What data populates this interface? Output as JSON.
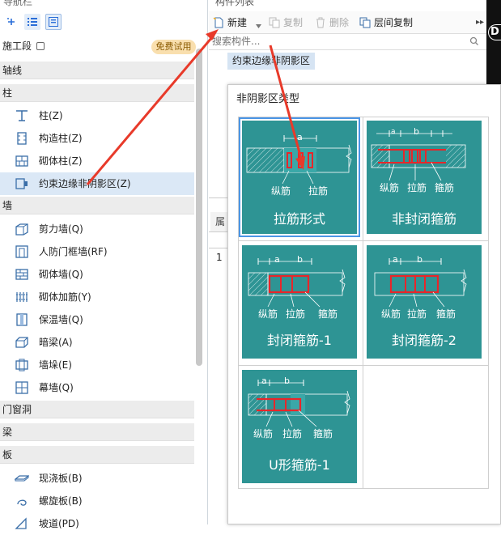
{
  "nav": {
    "title": "导航栏",
    "segment_label": "施工段",
    "free_badge": "免费试用",
    "groups": [
      {
        "label": "轴线"
      },
      {
        "label": "柱"
      },
      {
        "label": "墙"
      },
      {
        "label": "门窗洞"
      },
      {
        "label": "梁"
      },
      {
        "label": "板"
      }
    ],
    "items": [
      {
        "label": "柱(Z)",
        "icon": "column-icon"
      },
      {
        "label": "构造柱(Z)",
        "icon": "construction-column-icon"
      },
      {
        "label": "砌体柱(Z)",
        "icon": "masonry-column-icon"
      },
      {
        "label": "约束边缘非阴影区(Z)",
        "icon": "constraint-edge-icon"
      },
      {
        "label": "剪力墙(Q)",
        "icon": "shear-wall-icon"
      },
      {
        "label": "人防门框墙(RF)",
        "icon": "civil-defense-door-wall-icon"
      },
      {
        "label": "砌体墙(Q)",
        "icon": "masonry-wall-icon"
      },
      {
        "label": "砌体加筋(Y)",
        "icon": "masonry-rebar-icon"
      },
      {
        "label": "保温墙(Q)",
        "icon": "insulation-wall-icon"
      },
      {
        "label": "暗梁(A)",
        "icon": "hidden-beam-icon"
      },
      {
        "label": "墙垛(E)",
        "icon": "wall-pier-icon"
      },
      {
        "label": "幕墙(Q)",
        "icon": "curtain-wall-icon"
      },
      {
        "label": "现浇板(B)",
        "icon": "cast-slab-icon"
      },
      {
        "label": "螺旋板(B)",
        "icon": "spiral-slab-icon"
      },
      {
        "label": "坡道(PD)",
        "icon": "ramp-icon"
      }
    ]
  },
  "components": {
    "title": "构件列表",
    "toolbar": {
      "new_label": "新建",
      "copy_label": "复制",
      "delete_label": "删除",
      "floor_copy_label": "层间复制"
    },
    "search_placeholder": "搜索构件...",
    "selected_item": "约束边缘非阴影区",
    "props_header": "属",
    "props_row_index": "1"
  },
  "dark_panel_letter": "D",
  "dialog": {
    "title": "非阴影区类型",
    "cards": [
      {
        "caption": "拉筋形式",
        "labels": [
          "纵筋",
          "拉筋"
        ]
      },
      {
        "caption": "非封闭箍筋",
        "labels": [
          "纵筋",
          "拉筋",
          "箍筋"
        ]
      },
      {
        "caption": "封闭箍筋-1",
        "labels": [
          "纵筋",
          "拉筋",
          "箍筋"
        ]
      },
      {
        "caption": "封闭箍筋-2",
        "labels": [
          "纵筋",
          "拉筋",
          "箍筋"
        ]
      },
      {
        "caption": "U形箍筋-1",
        "labels": [
          "纵筋",
          "拉筋",
          "箍筋"
        ]
      }
    ],
    "dim_a": "a",
    "dim_b": "b"
  },
  "colors": {
    "card_bg": "#2e9494",
    "rebar_red": "#e8262a",
    "arrow_red": "#e83a2a",
    "selection_blue": "#4a95e6"
  }
}
